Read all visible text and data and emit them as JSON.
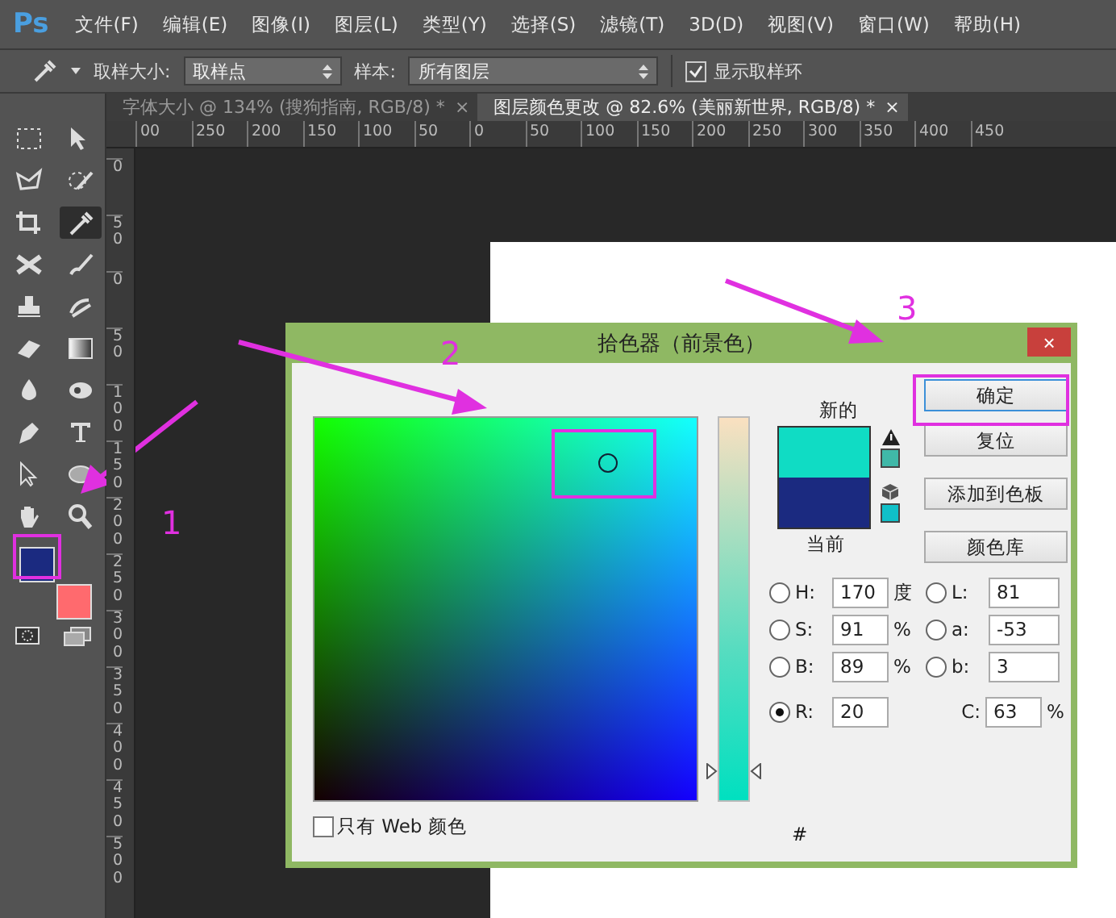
{
  "app_logo": "Ps",
  "menu": [
    "文件(F)",
    "编辑(E)",
    "图像(I)",
    "图层(L)",
    "类型(Y)",
    "选择(S)",
    "滤镜(T)",
    "3D(D)",
    "视图(V)",
    "窗口(W)",
    "帮助(H)"
  ],
  "options_bar": {
    "sample_size_label": "取样大小:",
    "sample_size_value": "取样点",
    "sample_label": "样本:",
    "sample_value": "所有图层",
    "show_ring": {
      "label": "显示取样环",
      "checked": true
    }
  },
  "doc_tabs": [
    {
      "label": "字体大小 @ 134% (搜狗指南, RGB/8) *",
      "close": "×",
      "selected": false
    },
    {
      "label": "图层颜色更改 @ 82.6% (美丽新世界, RGB/8) *",
      "close": "×",
      "selected": true
    }
  ],
  "ruler_h": [
    "00",
    "250",
    "200",
    "150",
    "100",
    "50",
    "0",
    "50",
    "100",
    "150",
    "200",
    "250",
    "300",
    "350",
    "400",
    "450"
  ],
  "ruler_v": [
    "0",
    "50",
    "0",
    "50",
    "100",
    "150",
    "200",
    "250",
    "300",
    "350",
    "400",
    "450",
    "500"
  ],
  "tools": [
    {
      "kind": "marquee",
      "selected": false
    },
    {
      "kind": "move",
      "selected": false
    },
    {
      "kind": "lasso",
      "selected": false
    },
    {
      "kind": "quick-select",
      "selected": false
    },
    {
      "kind": "crop",
      "selected": false
    },
    {
      "kind": "eyedropper",
      "selected": true
    },
    {
      "kind": "healing",
      "selected": false
    },
    {
      "kind": "brush",
      "selected": false
    },
    {
      "kind": "stamp",
      "selected": false
    },
    {
      "kind": "history-brush",
      "selected": false
    },
    {
      "kind": "eraser",
      "selected": false
    },
    {
      "kind": "gradient",
      "selected": false
    },
    {
      "kind": "blur",
      "selected": false
    },
    {
      "kind": "dodge",
      "selected": false
    },
    {
      "kind": "pen",
      "selected": false
    },
    {
      "kind": "type",
      "selected": false
    },
    {
      "kind": "path-select",
      "selected": false
    },
    {
      "kind": "ellipse",
      "selected": false
    },
    {
      "kind": "hand",
      "selected": false
    },
    {
      "kind": "zoom",
      "selected": false
    }
  ],
  "tool_colors": [
    {
      "kind": "foreground",
      "color": "#1b2a80"
    },
    {
      "kind": "background",
      "color": "#ff6a6e"
    }
  ],
  "dialog": {
    "title": "拾色器（前景色）",
    "close": "×",
    "hue_slider": {
      "level": 0.08
    },
    "web_only": {
      "label": "只有 Web 颜色",
      "checked": false
    },
    "new_label": "新的",
    "current_label": "当前",
    "swatches": [
      {
        "color": "#10dcc4"
      },
      {
        "color": "#1b2a80"
      }
    ],
    "gamut_swatches": [
      {
        "kind": "warning",
        "color": "#40b8a8"
      },
      {
        "kind": "web",
        "color": "#10c0c8"
      }
    ],
    "buttons": [
      "确定",
      "复位",
      "添加到色板",
      "颜色库"
    ],
    "fields_left": [
      {
        "label": "H:",
        "value": "170",
        "unit": "度",
        "selected": false
      },
      {
        "label": "S:",
        "value": "91",
        "unit": "%",
        "selected": false
      },
      {
        "label": "B:",
        "value": "89",
        "unit": "%",
        "selected": false
      },
      {
        "label": "R:",
        "value": "20",
        "selected": true
      }
    ],
    "fields_right": [
      {
        "kind": "radio",
        "label": "L:",
        "value": "81",
        "selected": false
      },
      {
        "kind": "radio",
        "label": "a:",
        "value": "-53",
        "selected": false
      },
      {
        "kind": "radio",
        "label": "b:",
        "value": "3",
        "selected": false
      },
      {
        "kind": "plain",
        "label": "C:",
        "value": "63",
        "unit": "%"
      }
    ],
    "hex_label": "#"
  },
  "annotations": [
    "1",
    "2",
    "3"
  ]
}
